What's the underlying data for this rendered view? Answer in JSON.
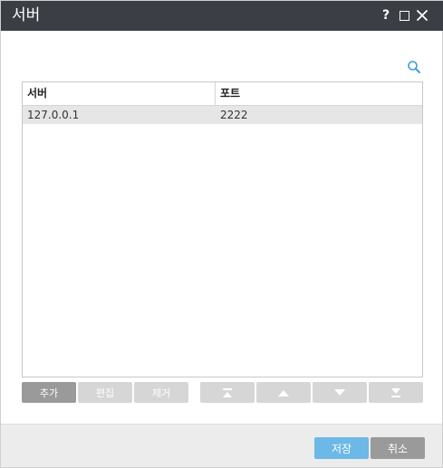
{
  "window": {
    "title": "서버",
    "help_label": "?"
  },
  "search": {
    "icon": "search-icon"
  },
  "table": {
    "columns": [
      "서버",
      "포트"
    ],
    "rows": [
      {
        "server": "127.0.0.1",
        "port": "2222",
        "selected": true
      }
    ]
  },
  "toolbar": {
    "add_label": "추가",
    "edit_label": "편집",
    "remove_label": "제거",
    "move_top_icon": "move-to-top-icon",
    "move_up_icon": "move-up-icon",
    "move_down_icon": "move-down-icon",
    "move_bottom_icon": "move-to-bottom-icon"
  },
  "footer": {
    "save_label": "저장",
    "cancel_label": "취소"
  },
  "colors": {
    "titlebar": "#3b3e44",
    "accent": "#6cb8e6",
    "button_active": "#9a9a9a",
    "button_disabled": "#d6d6d6",
    "selected_row": "#e6e6e6",
    "search_icon": "#3a9fd8"
  }
}
